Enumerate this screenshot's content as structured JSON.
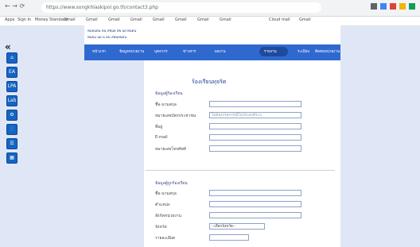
{
  "browser": {
    "url": "https://www.songkhlaskipol.go.th/contact3.php"
  },
  "bookmarks": [
    "Apps",
    "Sign In",
    "Money Standard",
    "Gmail",
    "Gmail",
    "Gmail",
    "Gmail",
    "Gmail",
    "Gmail",
    "Gmail",
    "Gmail",
    "Cloud mail",
    "Gmail"
  ],
  "sidebar": {
    "collapse": "«",
    "buttons": [
      "⌂",
      "EA",
      "LPA",
      "Lab",
      "⚙",
      "👤",
      "☰",
      "▦"
    ]
  },
  "header": {
    "line1": "พนยนตน ตน สพนย สพ นย พนตน",
    "line2": "พนยน นย น ตน สพนยนตน"
  },
  "navbar": {
    "items": [
      "หน้าแรก",
      "ข้อมูลหน่วยงาน",
      "บุคลากร",
      "ข่าวสาร",
      "ผลงาน",
      "รายงาน",
      "ระเบียบ",
      "ติดต่อหน่วยงาน"
    ],
    "active_index": 5
  },
  "form": {
    "title": "ร้องเรียนทุจริต",
    "section1": "ข้อมูลผู้ร้องเรียน",
    "fields1": [
      {
        "label": "ชื่อ-นามสกุล",
        "value": ""
      },
      {
        "label": "หมายเลขบัตรประชาชน",
        "value": "ไม่ต้องกรอกกรณีไม่ประสงค์ระบุ"
      },
      {
        "label": "ที่อยู่",
        "value": ""
      },
      {
        "label": "E-mail",
        "value": ""
      },
      {
        "label": "หมายเลขโทรศัพท์",
        "value": ""
      }
    ],
    "section2": "ข้อมูลผู้ถูกร้องเรียน",
    "fields2": [
      {
        "label": "ชื่อ-นามสกุล",
        "value": ""
      },
      {
        "label": "ตำแหน่ง",
        "value": ""
      },
      {
        "label": "สังกัดหน่วยงาน",
        "value": ""
      },
      {
        "label": "จังหวัด",
        "value": "--เลือกจังหวัด--"
      },
      {
        "label": "รายละเอียด",
        "value": ""
      }
    ]
  }
}
